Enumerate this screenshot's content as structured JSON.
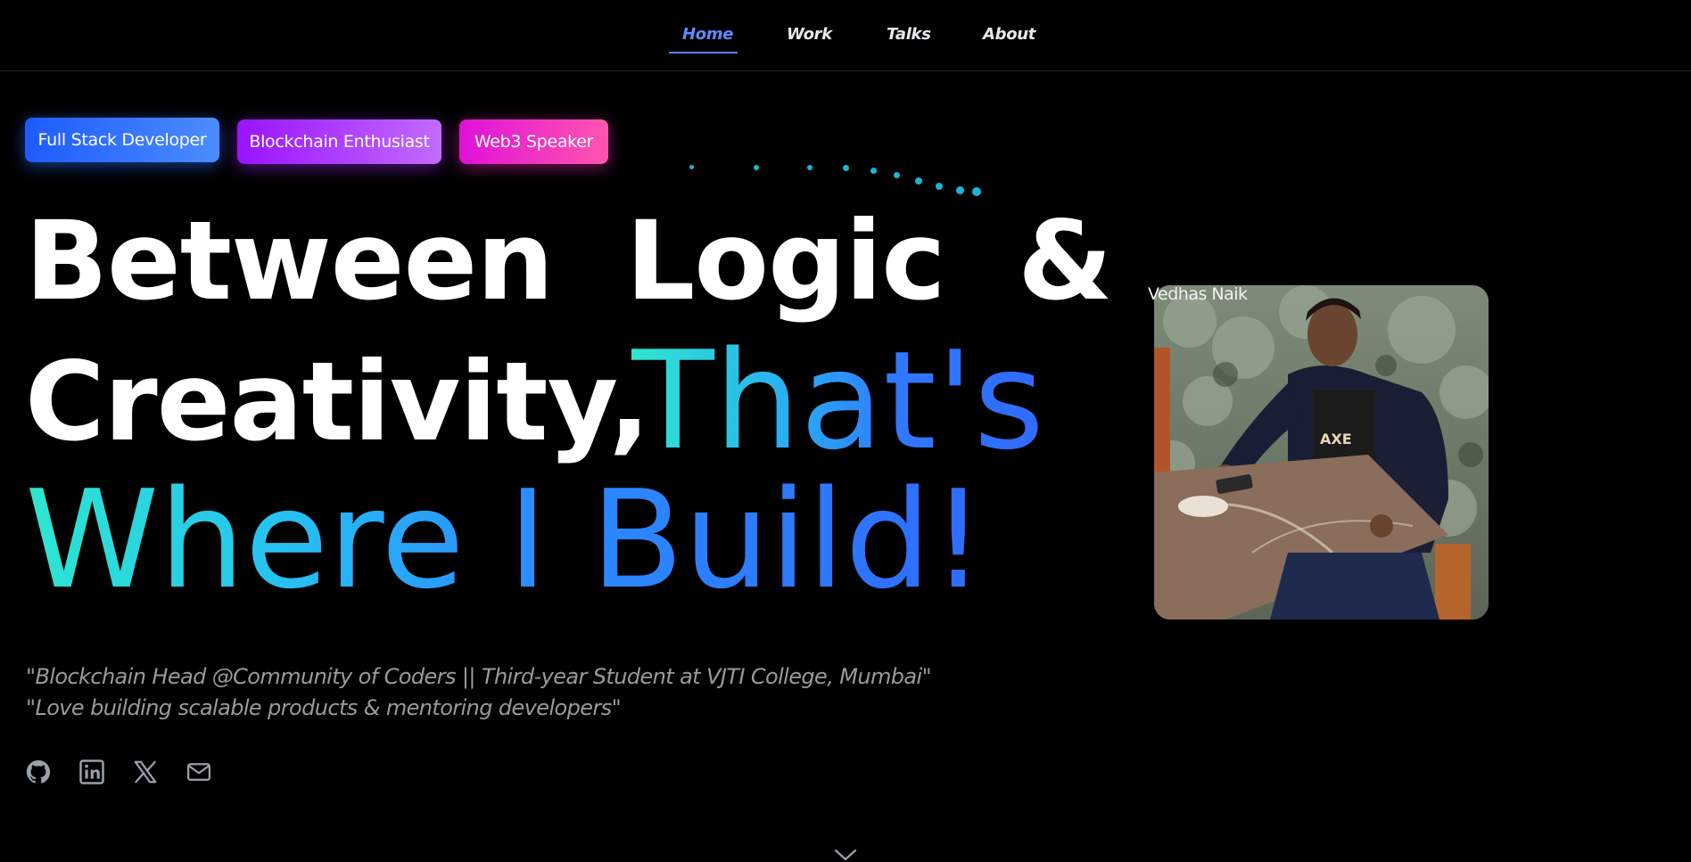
{
  "nav": {
    "items": [
      {
        "label": "Home",
        "active": true
      },
      {
        "label": "Work",
        "active": false
      },
      {
        "label": "Talks",
        "active": false
      },
      {
        "label": "About",
        "active": false
      }
    ]
  },
  "badges": [
    {
      "label": "Full Stack Developer"
    },
    {
      "label": "Blockchain Enthusiast"
    },
    {
      "label": "Web3 Speaker"
    }
  ],
  "headline": {
    "line1": "Between Logic &",
    "line2_white": "Creativity,",
    "line2_gradient": "That's",
    "line3": "Where I Build!"
  },
  "profile": {
    "name_label": "Vedhas Naik",
    "photo_alt": "Vedhas Naik"
  },
  "quotes": [
    "\"Blockchain Head @Community of Coders || Third-year Student at VJTI College, Mumbai\"",
    "\"Love building scalable products & mentoring developers\""
  ],
  "social": [
    {
      "icon": "github-icon"
    },
    {
      "icon": "linkedin-icon"
    },
    {
      "icon": "x-icon"
    },
    {
      "icon": "mail-icon"
    }
  ],
  "colors": {
    "background": "#000000",
    "accent_blue": "#4f86ff",
    "gradient_start": "#2ee6cf",
    "gradient_end": "#2f6bff"
  }
}
